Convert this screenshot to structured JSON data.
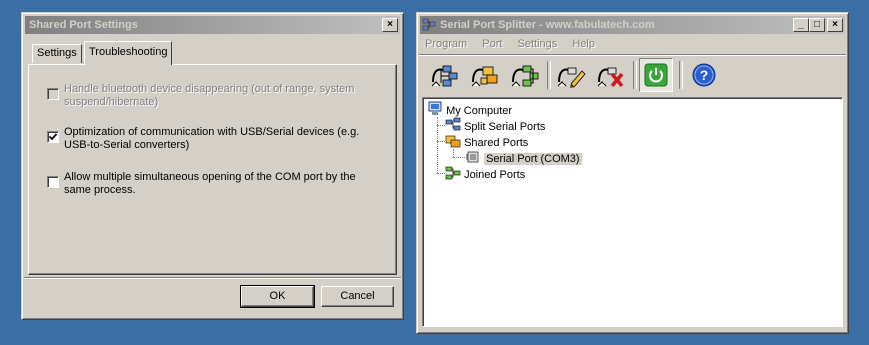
{
  "dialog": {
    "title": "Shared Port Settings",
    "tabs": [
      "Settings",
      "Troubleshooting"
    ],
    "options": [
      {
        "label": "Handle bluetooth device disappearing (out of range, system suspend/hibernate)",
        "checked": false,
        "disabled": true
      },
      {
        "label": "Optimization of communication with USB/Serial devices (e.g. USB-to-Serial converters)",
        "checked": true,
        "disabled": false
      },
      {
        "label": "Allow multiple simultaneous opening of the COM port by the same process.",
        "checked": false,
        "disabled": false
      }
    ],
    "ok_label": "OK",
    "cancel_label": "Cancel"
  },
  "app": {
    "title": "Serial Port Splitter - www.fabulatech.com",
    "menu": [
      "Program",
      "Port",
      "Settings",
      "Help"
    ],
    "title_buttons": [
      "_",
      "□",
      "×"
    ],
    "toolbar_icons": [
      "split-port-icon",
      "share-port-icon",
      "join-port-icon",
      "edit-port-icon",
      "delete-port-icon",
      "power-icon",
      "help-icon"
    ],
    "help_glyph": "?",
    "tree": {
      "root": "My Computer",
      "split": "Split Serial Ports",
      "shared": "Shared Ports",
      "shared_child": "Serial Port (COM3)",
      "joined": "Joined Ports"
    }
  },
  "colors": {
    "desktop": "#3a6ea5",
    "title_active": "#0a246a",
    "face": "#d4d0c8",
    "power_green": "#3aa53a",
    "help_blue": "#2a5fd0"
  }
}
